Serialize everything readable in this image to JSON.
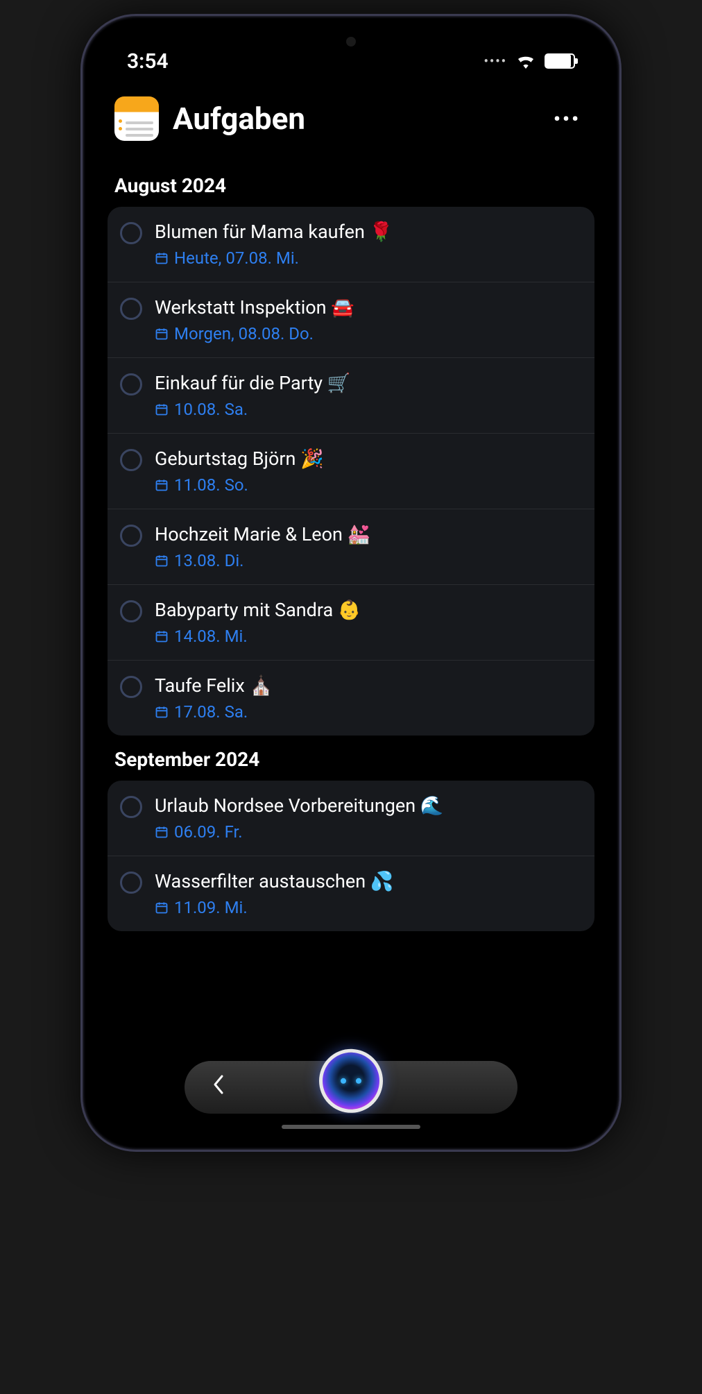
{
  "status": {
    "time": "3:54"
  },
  "header": {
    "title": "Aufgaben"
  },
  "sections": [
    {
      "label": "August 2024",
      "tasks": [
        {
          "title": "Blumen für Mama kaufen 🌹",
          "date": "Heute, 07.08. Mi."
        },
        {
          "title": "Werkstatt Inspektion 🚘",
          "date": "Morgen, 08.08. Do."
        },
        {
          "title": "Einkauf für die Party 🛒",
          "date": "10.08. Sa."
        },
        {
          "title": "Geburtstag Björn 🎉",
          "date": "11.08. So."
        },
        {
          "title": "Hochzeit Marie & Leon 💒",
          "date": "13.08. Di."
        },
        {
          "title": "Babyparty mit Sandra 👶",
          "date": "14.08. Mi."
        },
        {
          "title": "Taufe Felix ⛪",
          "date": "17.08. Sa."
        }
      ]
    },
    {
      "label": "September 2024",
      "tasks": [
        {
          "title": "Urlaub Nordsee Vorbereitungen 🌊",
          "date": "06.09. Fr."
        },
        {
          "title": "Wasserfilter austauschen 💦",
          "date": "11.09. Mi."
        }
      ]
    }
  ],
  "colors": {
    "accent": "#2e7ff0",
    "card": "#17191d"
  }
}
